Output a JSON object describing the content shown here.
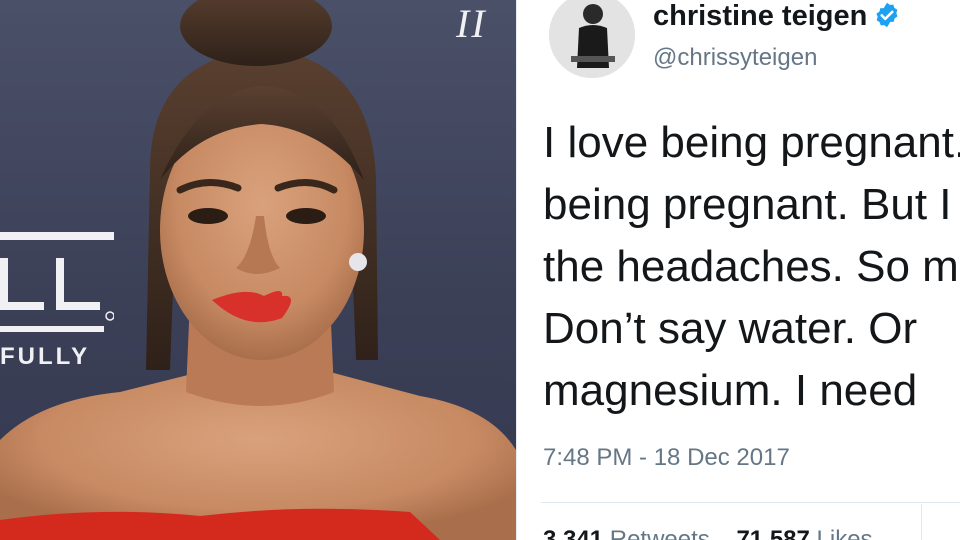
{
  "photo": {
    "backdrop_logo_text": "LL",
    "backdrop_word": "FULLY",
    "backdrop_italic": "II"
  },
  "tweet": {
    "display_name": "christine teigen",
    "handle": "@chrissyteigen",
    "text_lines": [
      "I love being pregnant. I hate",
      "being pregnant. But I hate",
      "the headaches. So much.",
      "Don’t say water. Or",
      "magnesium. I need"
    ],
    "timestamp": "7:48 PM - 18 Dec 2017",
    "retweets_count": "3,341",
    "retweets_label": "Retweets",
    "likes_count": "71,587",
    "likes_label": "Likes"
  },
  "colors": {
    "verified_badge": "#1da1f2",
    "text_primary": "#14171a",
    "text_secondary": "#657786",
    "lipstick": "#d8302a",
    "dress": "#d42a1e"
  },
  "icons": [
    "verified-badge-icon"
  ]
}
